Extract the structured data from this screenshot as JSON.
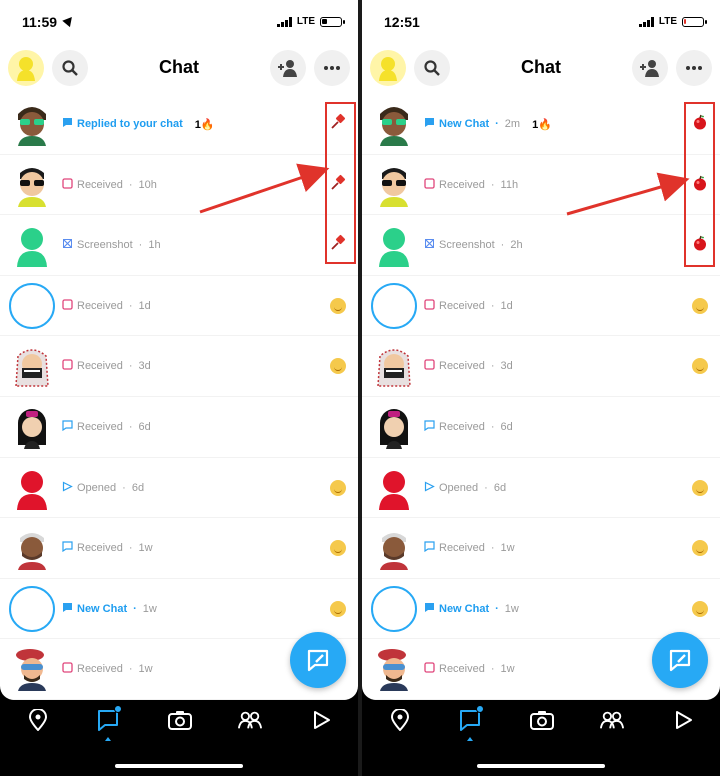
{
  "left": {
    "status_time": "11:59",
    "network": "LTE",
    "battery_color": "#000000",
    "battery_level": 0.3,
    "title": "Chat",
    "rows": [
      {
        "status": "Replied to your chat",
        "style": "blue",
        "icon": "chat-filled-icon",
        "time": "",
        "streak": "1🔥",
        "avatar": "bitmoji-green-glasses",
        "mark": "pin"
      },
      {
        "status": "Received",
        "style": "normal",
        "icon": "received-square-icon",
        "time": "10h",
        "streak": "",
        "avatar": "bitmoji-sunglasses",
        "mark": "pin"
      },
      {
        "status": "Screenshot",
        "style": "normal",
        "icon": "screenshot-icon",
        "time": "1h",
        "streak": "",
        "avatar": "ghost-green",
        "mark": "pin"
      },
      {
        "status": "Received",
        "style": "normal",
        "icon": "received-square-icon",
        "time": "1d",
        "streak": "",
        "avatar": "empty-circle",
        "mark": "smile"
      },
      {
        "status": "Received",
        "style": "normal",
        "icon": "received-square-icon",
        "time": "3d",
        "streak": "",
        "avatar": "bitmoji-keffiyeh",
        "mark": "smile"
      },
      {
        "status": "Received",
        "style": "normal",
        "icon": "received-chat-icon",
        "time": "6d",
        "streak": "",
        "avatar": "bitmoji-dark-hair",
        "mark": "none"
      },
      {
        "status": "Opened",
        "style": "normal",
        "icon": "opened-arrow-icon",
        "time": "6d",
        "streak": "",
        "avatar": "ghost-red",
        "mark": "smile"
      },
      {
        "status": "Received",
        "style": "normal",
        "icon": "received-chat-icon",
        "time": "1w",
        "streak": "",
        "avatar": "bitmoji-cap",
        "mark": "smile"
      },
      {
        "status": "New Chat",
        "style": "blue",
        "icon": "chat-filled-icon",
        "time": "1w",
        "streak": "",
        "avatar": "empty-circle",
        "mark": "smile"
      },
      {
        "status": "Received",
        "style": "normal",
        "icon": "received-square-icon",
        "time": "1w",
        "streak": "",
        "avatar": "bitmoji-beret",
        "mark": "none"
      }
    ]
  },
  "right": {
    "status_time": "12:51",
    "network": "LTE",
    "battery_color": "#e0332b",
    "battery_level": 0.1,
    "title": "Chat",
    "rows": [
      {
        "status": "New Chat",
        "style": "blue",
        "icon": "chat-filled-icon",
        "time": "2m",
        "streak": "1🔥",
        "avatar": "bitmoji-green-glasses",
        "mark": "apple"
      },
      {
        "status": "Received",
        "style": "normal",
        "icon": "received-square-icon",
        "time": "11h",
        "streak": "",
        "avatar": "bitmoji-sunglasses",
        "mark": "apple"
      },
      {
        "status": "Screenshot",
        "style": "normal",
        "icon": "screenshot-icon",
        "time": "2h",
        "streak": "",
        "avatar": "ghost-green",
        "mark": "apple"
      },
      {
        "status": "Received",
        "style": "normal",
        "icon": "received-square-icon",
        "time": "1d",
        "streak": "",
        "avatar": "empty-circle",
        "mark": "smile"
      },
      {
        "status": "Received",
        "style": "normal",
        "icon": "received-square-icon",
        "time": "3d",
        "streak": "",
        "avatar": "bitmoji-keffiyeh",
        "mark": "smile"
      },
      {
        "status": "Received",
        "style": "normal",
        "icon": "received-chat-icon",
        "time": "6d",
        "streak": "",
        "avatar": "bitmoji-dark-hair",
        "mark": "none"
      },
      {
        "status": "Opened",
        "style": "normal",
        "icon": "opened-arrow-icon",
        "time": "6d",
        "streak": "",
        "avatar": "ghost-red",
        "mark": "smile"
      },
      {
        "status": "Received",
        "style": "normal",
        "icon": "received-chat-icon",
        "time": "1w",
        "streak": "",
        "avatar": "bitmoji-cap",
        "mark": "smile"
      },
      {
        "status": "New Chat",
        "style": "blue",
        "icon": "chat-filled-icon",
        "time": "1w",
        "streak": "",
        "avatar": "empty-circle",
        "mark": "smile"
      },
      {
        "status": "Received",
        "style": "normal",
        "icon": "received-square-icon",
        "time": "1w",
        "streak": "",
        "avatar": "bitmoji-beret",
        "mark": "none"
      }
    ]
  },
  "colors": {
    "accent": "#27a9f5",
    "annotation": "#e0332b",
    "received": "#e0457b",
    "received_chat": "#2aa0f0",
    "screenshot": "#5b8def",
    "opened": "#2aa0f0"
  },
  "nav_icons": [
    "map-pin-icon",
    "chat-icon",
    "camera-icon",
    "friends-icon",
    "stories-play-icon"
  ]
}
